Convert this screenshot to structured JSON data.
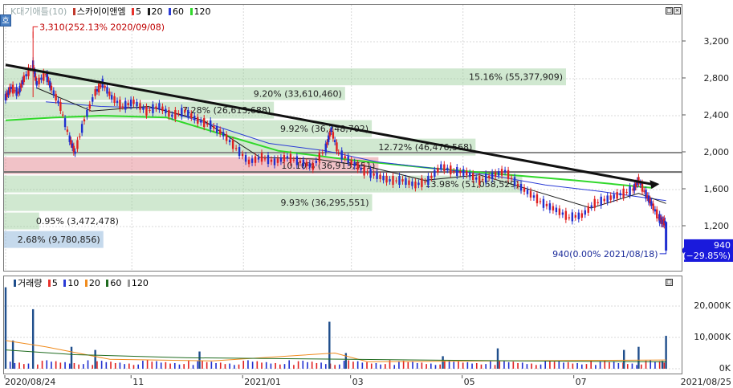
{
  "legend_top": {
    "title": "K대기애틀(10)",
    "stock": "스카이이앤엠",
    "ma": [
      {
        "label": "5",
        "color": "#e8322c"
      },
      {
        "label": "20",
        "color": "#1a1a1a"
      },
      {
        "label": "60",
        "color": "#2b3bd6"
      },
      {
        "label": "120",
        "color": "#30d82a"
      }
    ]
  },
  "legend_bottom": {
    "title": "거래량",
    "ma": [
      {
        "label": "5",
        "color": "#e8322c"
      },
      {
        "label": "10",
        "color": "#2b3bd6"
      },
      {
        "label": "20",
        "color": "#f08c1e"
      },
      {
        "label": "60",
        "color": "#1f6b1f"
      },
      {
        "label": "120",
        "color": "#999999"
      }
    ]
  },
  "side_button": "호",
  "annotations": {
    "high": "3,310(252.13% 2020/09/08)",
    "low": "940(0.00% 2021/08/18)",
    "current_price": "940",
    "current_change": "(−29.85%)"
  },
  "x_tick_labels": [
    "2020/08/24",
    "11",
    "2021/01",
    "03",
    "05",
    "07",
    "2021/08/25"
  ],
  "volume_axis_labels": [
    "20,000K",
    "10,000K",
    "0K"
  ],
  "chart_data": {
    "type": "candlestick",
    "price_axis": {
      "ticks": [
        1200,
        1600,
        2000,
        2400,
        2800,
        3200
      ],
      "tick_labels": [
        "1,200",
        "1,600",
        "2,000",
        "2,400",
        "2,800",
        "3,200"
      ],
      "range": [
        940,
        3500
      ]
    },
    "volume_axis": {
      "ticks": [
        0,
        10000,
        20000
      ],
      "unit": "K",
      "range": [
        0,
        28000
      ]
    },
    "x_range": [
      "2020-08-24",
      "2021-08-25"
    ],
    "trendline": {
      "from": {
        "date": "2020-08-24",
        "price": 2950
      },
      "to": {
        "date": "2021-08-12",
        "price": 1660
      }
    },
    "horizontal_lines": [
      {
        "price": 2000,
        "color": "#8a8a8a"
      },
      {
        "price": 1790,
        "color": "#6b6b6b"
      }
    ],
    "volume_profile": [
      {
        "label": "15.16% (55,377,909)",
        "top": 2920,
        "bottom": 2720,
        "pct": 15.16
      },
      {
        "label": "9.20% (33,610,460)",
        "top": 2720,
        "bottom": 2560,
        "pct": 9.2
      },
      {
        "label": "7.28% (26,613,688)",
        "top": 2560,
        "bottom": 2360,
        "pct": 7.28
      },
      {
        "label": "9.92% (36,248,702)",
        "top": 2360,
        "bottom": 2160,
        "pct": 9.92
      },
      {
        "label": "12.72% (46,476,568)",
        "top": 2160,
        "bottom": 1960,
        "pct": 12.72
      },
      {
        "label": "10.10% (36,913,551)",
        "top": 1960,
        "bottom": 1760,
        "pct": 10.1,
        "highlight": true
      },
      {
        "label": "13.98% (51,058,529)",
        "top": 1760,
        "bottom": 1560,
        "pct": 13.98
      },
      {
        "label": "9.93% (36,295,551)",
        "top": 1560,
        "bottom": 1360,
        "pct": 9.93
      },
      {
        "label": "0.95% (3,472,478)",
        "top": 1360,
        "bottom": 1160,
        "pct": 0.95
      },
      {
        "label": "2.68% (9,780,856)",
        "top": 1160,
        "bottom": 960,
        "pct": 2.68,
        "current": true
      }
    ],
    "price_path": [
      [
        "2020-08-24",
        2600
      ],
      [
        "2020-08-27",
        2700
      ],
      [
        "2020-08-31",
        2650
      ],
      [
        "2020-09-03",
        2800
      ],
      [
        "2020-09-08",
        2950
      ],
      [
        "2020-09-10",
        2750
      ],
      [
        "2020-09-15",
        2850
      ],
      [
        "2020-09-18",
        2700
      ],
      [
        "2020-09-23",
        2500
      ],
      [
        "2020-09-28",
        2150
      ],
      [
        "2020-10-01",
        2000
      ],
      [
        "2020-10-06",
        2350
      ],
      [
        "2020-10-12",
        2650
      ],
      [
        "2020-10-16",
        2750
      ],
      [
        "2020-10-21",
        2600
      ],
      [
        "2020-10-27",
        2500
      ],
      [
        "2020-11-02",
        2550
      ],
      [
        "2020-11-09",
        2450
      ],
      [
        "2020-11-16",
        2500
      ],
      [
        "2020-11-23",
        2400
      ],
      [
        "2020-11-30",
        2450
      ],
      [
        "2020-12-07",
        2350
      ],
      [
        "2020-12-14",
        2300
      ],
      [
        "2020-12-21",
        2200
      ],
      [
        "2020-12-28",
        2050
      ],
      [
        "2021-01-04",
        1900
      ],
      [
        "2021-01-11",
        1950
      ],
      [
        "2021-01-18",
        1900
      ],
      [
        "2021-01-25",
        1950
      ],
      [
        "2021-02-01",
        1900
      ],
      [
        "2021-02-08",
        1850
      ],
      [
        "2021-02-15",
        2050
      ],
      [
        "2021-02-18",
        2250
      ],
      [
        "2021-02-22",
        2000
      ],
      [
        "2021-03-01",
        1900
      ],
      [
        "2021-03-08",
        1800
      ],
      [
        "2021-03-15",
        1750
      ],
      [
        "2021-03-22",
        1700
      ],
      [
        "2021-03-29",
        1700
      ],
      [
        "2021-04-05",
        1650
      ],
      [
        "2021-04-12",
        1700
      ],
      [
        "2021-04-19",
        1850
      ],
      [
        "2021-04-26",
        1800
      ],
      [
        "2021-05-03",
        1780
      ],
      [
        "2021-05-10",
        1700
      ],
      [
        "2021-05-17",
        1750
      ],
      [
        "2021-05-24",
        1800
      ],
      [
        "2021-05-31",
        1650
      ],
      [
        "2021-06-07",
        1550
      ],
      [
        "2021-06-14",
        1450
      ],
      [
        "2021-06-21",
        1380
      ],
      [
        "2021-06-28",
        1300
      ],
      [
        "2021-07-05",
        1320
      ],
      [
        "2021-07-12",
        1450
      ],
      [
        "2021-07-19",
        1500
      ],
      [
        "2021-07-26",
        1550
      ],
      [
        "2021-08-02",
        1600
      ],
      [
        "2021-08-05",
        1700
      ],
      [
        "2021-08-09",
        1550
      ],
      [
        "2021-08-12",
        1450
      ],
      [
        "2021-08-16",
        1300
      ],
      [
        "2021-08-18",
        1250
      ],
      [
        "2021-08-20",
        1250
      ]
    ],
    "ma_paths": {
      "ma120": [
        [
          "2020-08-24",
          2350
        ],
        [
          "2020-09-20",
          2380
        ],
        [
          "2020-10-15",
          2400
        ],
        [
          "2020-11-20",
          2380
        ],
        [
          "2020-12-20",
          2200
        ],
        [
          "2021-01-20",
          2020
        ],
        [
          "2021-03-01",
          1920
        ],
        [
          "2021-04-15",
          1830
        ],
        [
          "2021-06-01",
          1750
        ],
        [
          "2021-07-01",
          1700
        ],
        [
          "2021-08-12",
          1620
        ]
      ],
      "ma60": [
        [
          "2020-09-15",
          2550
        ],
        [
          "2020-10-15",
          2500
        ],
        [
          "2020-11-15",
          2480
        ],
        [
          "2020-12-15",
          2300
        ],
        [
          "2021-01-15",
          2100
        ],
        [
          "2021-02-15",
          2020
        ],
        [
          "2021-03-15",
          1900
        ],
        [
          "2021-04-15",
          1830
        ],
        [
          "2021-05-15",
          1760
        ],
        [
          "2021-06-15",
          1650
        ],
        [
          "2021-07-15",
          1580
        ],
        [
          "2021-08-20",
          1480
        ]
      ],
      "ma20": [
        [
          "2020-09-10",
          2700
        ],
        [
          "2020-10-10",
          2450
        ],
        [
          "2020-11-10",
          2500
        ],
        [
          "2020-12-10",
          2350
        ],
        [
          "2021-01-10",
          1950
        ],
        [
          "2021-02-10",
          1930
        ],
        [
          "2021-03-10",
          1850
        ],
        [
          "2021-04-10",
          1700
        ],
        [
          "2021-05-10",
          1760
        ],
        [
          "2021-06-10",
          1580
        ],
        [
          "2021-07-10",
          1400
        ],
        [
          "2021-08-05",
          1560
        ],
        [
          "2021-08-20",
          1450
        ]
      ]
    },
    "last_candle": {
      "date": "2021-08-20",
      "open": 1250,
      "close": 940,
      "high": 1260,
      "low": 940
    },
    "volume_spikes": [
      [
        "2020-08-24",
        26000
      ],
      [
        "2020-08-28",
        9000
      ],
      [
        "2020-09-08",
        19000
      ],
      [
        "2020-09-29",
        7000
      ],
      [
        "2020-10-12",
        6000
      ],
      [
        "2020-12-08",
        5500
      ],
      [
        "2021-02-17",
        15000
      ],
      [
        "2021-02-26",
        5000
      ],
      [
        "2021-04-20",
        4000
      ],
      [
        "2021-05-20",
        6500
      ],
      [
        "2021-07-28",
        6000
      ],
      [
        "2021-08-05",
        7000
      ],
      [
        "2021-08-18",
        2500
      ],
      [
        "2021-08-20",
        10500
      ]
    ]
  }
}
